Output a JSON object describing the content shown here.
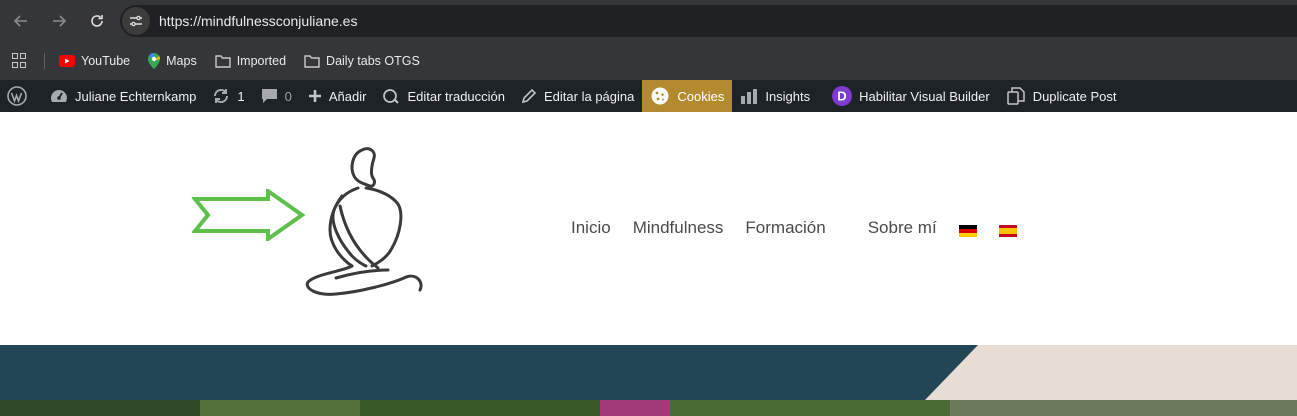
{
  "browser": {
    "url": "https://mindfulnessconjuliane.es"
  },
  "bookmarks": [
    {
      "label": "YouTube",
      "icon": "youtube-icon"
    },
    {
      "label": "Maps",
      "icon": "maps-icon"
    },
    {
      "label": "Imported",
      "icon": "folder-icon"
    },
    {
      "label": "Daily tabs OTGS",
      "icon": "folder-icon"
    }
  ],
  "wpbar": {
    "user": "Juliane Echternkamp",
    "updates": "1",
    "comments": "0",
    "add": "Añadir",
    "translate": "Editar traducción",
    "edit_page": "Editar la página",
    "cookies": "Cookies",
    "insights": "Insights",
    "visual_builder": "Habilitar Visual Builder",
    "duplicate": "Duplicate Post"
  },
  "menu": {
    "items": [
      "Inicio",
      "Mindfulness",
      "Formación",
      "Sobre mí"
    ]
  },
  "colors": {
    "banner_teal": "#234657",
    "banner_beige": "#e8ddd4",
    "cookies_bg": "#b48a2f",
    "arrow_green": "#5cc04a"
  }
}
